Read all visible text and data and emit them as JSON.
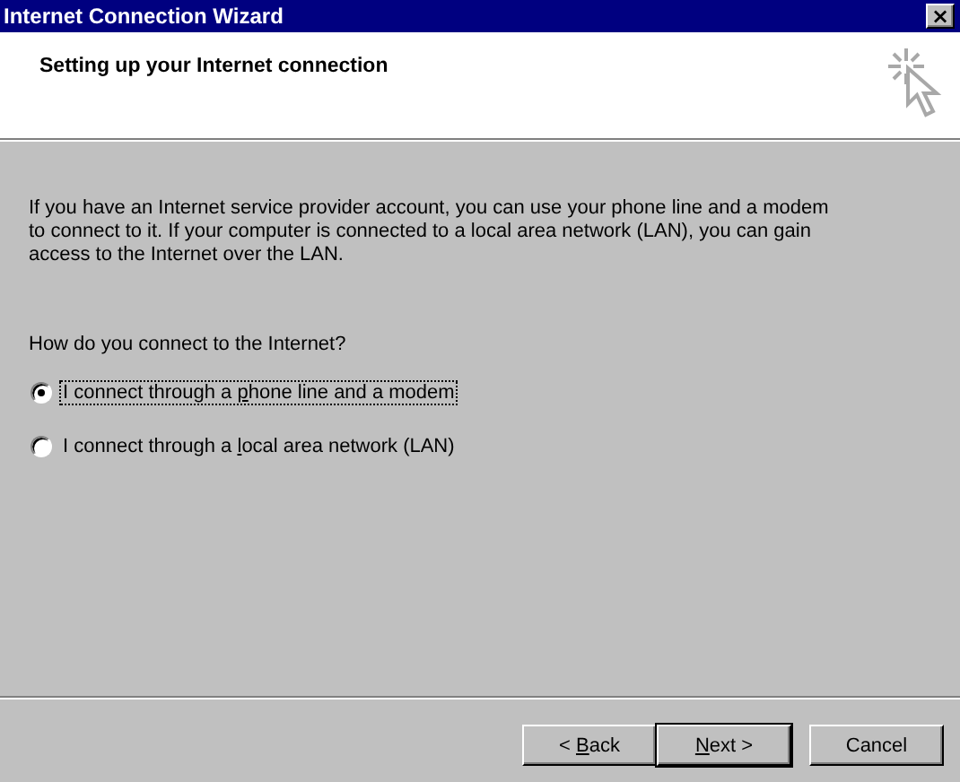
{
  "window": {
    "title": "Internet Connection Wizard",
    "close": "×"
  },
  "header": {
    "title": "Setting up your Internet connection"
  },
  "intro": "If you have an Internet service provider account, you can use your phone line and a modem to connect to it. If your computer is connected to a local area network (LAN), you can gain access to the Internet over the LAN.",
  "question": "How do you connect to the Internet?",
  "options": [
    {
      "label_parts": {
        "before": "I connect through a ",
        "key": "p",
        "after": "hone line and a modem"
      },
      "selected": true,
      "focused": true
    },
    {
      "label_parts": {
        "before": "I connect through a ",
        "key": "l",
        "after": "ocal area network (LAN)"
      },
      "selected": false,
      "focused": false
    }
  ],
  "buttons": [
    {
      "label_parts": {
        "before": "< ",
        "key": "B",
        "after": "ack"
      },
      "default": false
    },
    {
      "label_parts": {
        "key": "N",
        "after": "ext >"
      },
      "default": true
    },
    {
      "label_parts": {
        "before": "Cancel"
      },
      "default": false
    }
  ]
}
